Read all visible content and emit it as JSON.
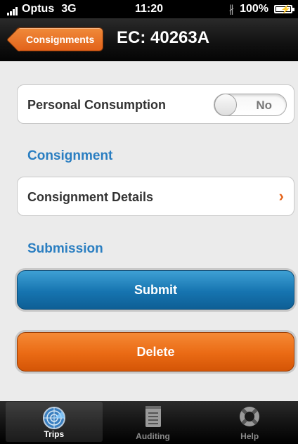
{
  "status_bar": {
    "carrier": "Optus",
    "network": "3G",
    "time": "11:20",
    "battery": "100%"
  },
  "nav": {
    "back_label": "Consignments",
    "title": "EC: 40263A"
  },
  "personal_consumption": {
    "label": "Personal Consumption",
    "toggle_value": "No"
  },
  "sections": {
    "consignment": "Consignment",
    "submission": "Submission"
  },
  "consignment_details": {
    "label": "Consignment Details",
    "chevron": "›"
  },
  "buttons": {
    "submit": "Submit",
    "delete": "Delete"
  },
  "tabs": [
    {
      "label": "Trips",
      "icon": "radar-icon",
      "selected": true
    },
    {
      "label": "Auditing",
      "icon": "notepad-icon",
      "selected": false
    },
    {
      "label": "Help",
      "icon": "lifebuoy-icon",
      "selected": false
    }
  ],
  "colors": {
    "accent_blue": "#2a7ec1",
    "accent_orange": "#e5661e"
  }
}
